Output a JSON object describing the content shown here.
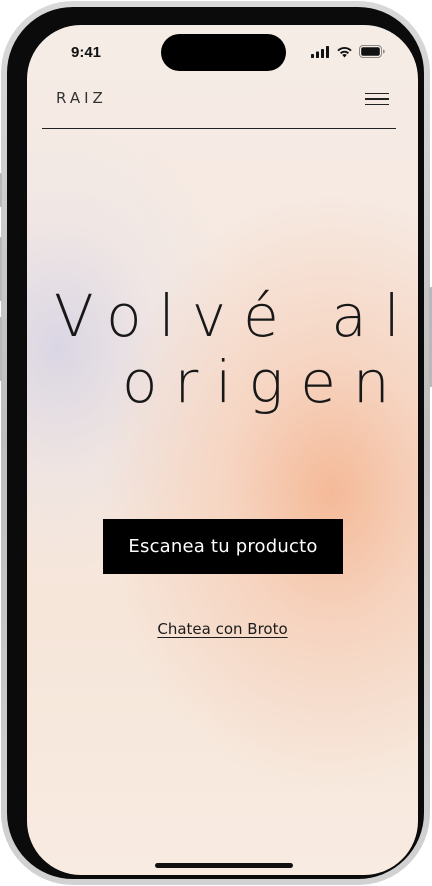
{
  "status_bar": {
    "time": "9:41",
    "icons": [
      "signal-icon",
      "wifi-icon",
      "battery-icon"
    ]
  },
  "header": {
    "logo": "RAIZ",
    "menu_icon": "hamburger-menu-icon"
  },
  "hero": {
    "line1": "Volvé al",
    "line2": "origen"
  },
  "actions": {
    "primary_label": "Escanea tu producto",
    "secondary_label": "Chatea con Broto"
  },
  "colors": {
    "text": "#181818",
    "button_bg": "#000000",
    "button_text": "#ffffff",
    "accent_glow": "#f5b28c"
  }
}
